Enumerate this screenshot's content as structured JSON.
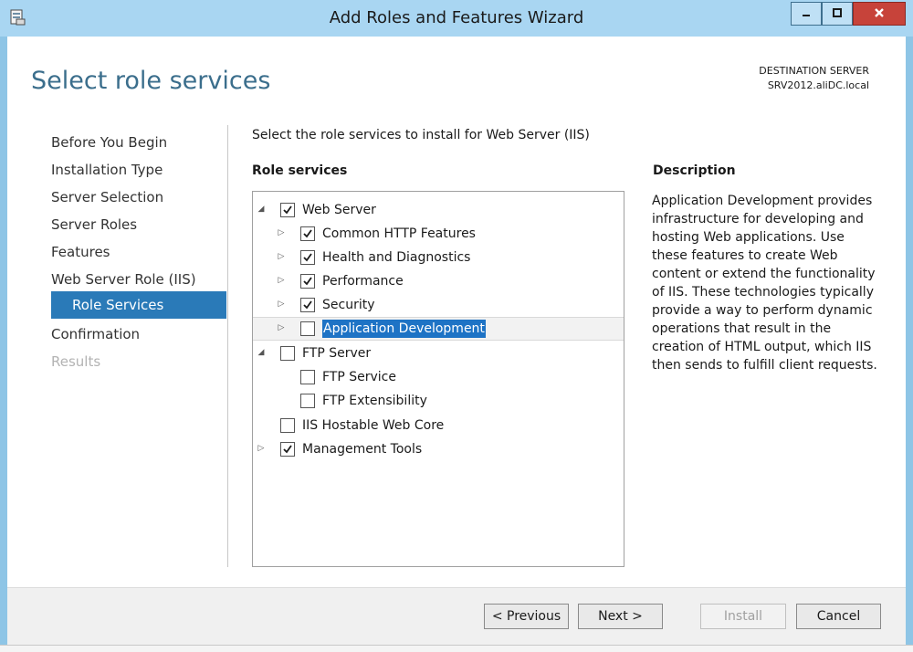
{
  "window": {
    "title": "Add Roles and Features Wizard",
    "icons": {
      "app": "server-manager-icon",
      "minimize": "minimize-icon",
      "maximize": "maximize-icon",
      "close": "close-icon"
    },
    "colors": {
      "titlebar": "#a9d6f2",
      "close_button": "#c7433a",
      "accent": "#2a7ab8"
    }
  },
  "header": {
    "page_title": "Select role services",
    "destination_label": "DESTINATION SERVER",
    "destination_value": "SRV2012.aliDC.local"
  },
  "nav": {
    "items": [
      {
        "label": "Before You Begin",
        "state": "normal"
      },
      {
        "label": "Installation Type",
        "state": "normal"
      },
      {
        "label": "Server Selection",
        "state": "normal"
      },
      {
        "label": "Server Roles",
        "state": "normal"
      },
      {
        "label": "Features",
        "state": "normal"
      },
      {
        "label": "Web Server Role (IIS)",
        "state": "normal"
      },
      {
        "label": "Role Services",
        "state": "selected"
      },
      {
        "label": "Confirmation",
        "state": "normal"
      },
      {
        "label": "Results",
        "state": "disabled"
      }
    ]
  },
  "main": {
    "instruction": "Select the role services to install for Web Server (IIS)",
    "role_services_heading": "Role services",
    "tree": [
      {
        "label": "Web Server",
        "checked": true,
        "expander": "expanded",
        "level": 0
      },
      {
        "label": "Common HTTP Features",
        "checked": true,
        "expander": "collapsed",
        "level": 1
      },
      {
        "label": "Health and Diagnostics",
        "checked": true,
        "expander": "collapsed",
        "level": 1
      },
      {
        "label": "Performance",
        "checked": true,
        "expander": "collapsed",
        "level": 1
      },
      {
        "label": "Security",
        "checked": true,
        "expander": "collapsed",
        "level": 1
      },
      {
        "label": "Application Development",
        "checked": false,
        "expander": "collapsed",
        "level": 1,
        "selected": true
      },
      {
        "label": "FTP Server",
        "checked": false,
        "expander": "expanded",
        "level": 0
      },
      {
        "label": "FTP Service",
        "checked": false,
        "expander": "none",
        "level": 1
      },
      {
        "label": "FTP Extensibility",
        "checked": false,
        "expander": "none",
        "level": 1
      },
      {
        "label": "IIS Hostable Web Core",
        "checked": false,
        "expander": "none",
        "level": 0
      },
      {
        "label": "Management Tools",
        "checked": true,
        "expander": "collapsed",
        "level": 0
      }
    ],
    "description_heading": "Description",
    "description_text": "Application Development provides infrastructure for developing and hosting Web applications. Use these features to create Web content or extend the functionality of IIS. These technologies typically provide a way to perform dynamic operations that result in the creation of HTML output, which IIS then sends to fulfill client requests."
  },
  "footer": {
    "previous_label": "< Previous",
    "next_label": "Next >",
    "install_label": "Install",
    "cancel_label": "Cancel"
  }
}
